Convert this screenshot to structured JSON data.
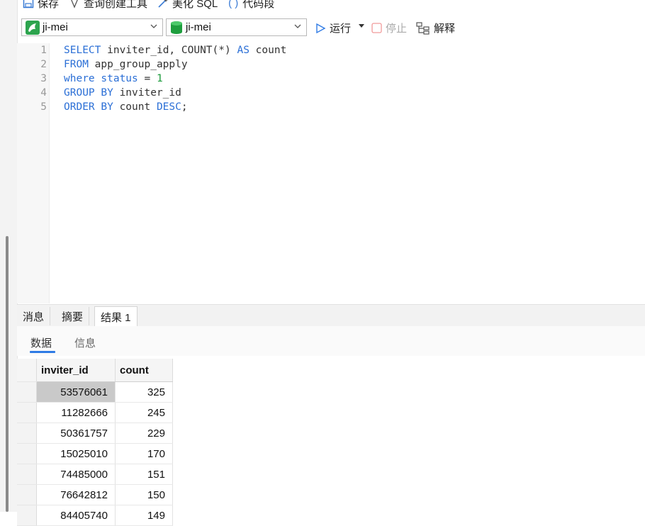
{
  "toolbar_top": {
    "save_label": "保存",
    "query_builder_label": "查询创建工具",
    "beautify_label": "美化 SQL",
    "snippet_label": "代码段"
  },
  "toolbar": {
    "connection_value": "ji-mei",
    "database_value": "ji-mei",
    "run_label": "运行",
    "stop_label": "停止",
    "explain_label": "解释",
    "colors": {
      "connection_icon": "#2da44e",
      "database_icon": "#1e9e3e",
      "run_icon": "#2f7be5"
    }
  },
  "editor": {
    "line_numbers": [
      "1",
      "2",
      "3",
      "4",
      "5"
    ],
    "lines": [
      [
        {
          "t": "SELECT",
          "k": "kw"
        },
        {
          "t": " inviter_id, ",
          "k": "id"
        },
        {
          "t": "COUNT(*)",
          "k": "id"
        },
        {
          "t": " ",
          "k": "id"
        },
        {
          "t": "AS",
          "k": "kw"
        },
        {
          "t": " count",
          "k": "id"
        }
      ],
      [
        {
          "t": "FROM",
          "k": "kw"
        },
        {
          "t": " app_group_apply",
          "k": "id"
        }
      ],
      [
        {
          "t": "where",
          "k": "kw"
        },
        {
          "t": " ",
          "k": "id"
        },
        {
          "t": "status",
          "k": "kw"
        },
        {
          "t": " = ",
          "k": "id"
        },
        {
          "t": "1",
          "k": "num"
        }
      ],
      [
        {
          "t": "GROUP BY",
          "k": "kw"
        },
        {
          "t": " inviter_id",
          "k": "id"
        }
      ],
      [
        {
          "t": "ORDER BY",
          "k": "kw"
        },
        {
          "t": " count ",
          "k": "id"
        },
        {
          "t": "DESC",
          "k": "kw"
        },
        {
          "t": ";",
          "k": "id"
        }
      ]
    ]
  },
  "result_tabs": [
    "消息",
    "摘要",
    "结果 1"
  ],
  "sub_tabs": [
    "数据",
    "信息"
  ],
  "grid": {
    "columns": [
      "inviter_id",
      "count"
    ],
    "rows": [
      [
        "53576061",
        "325"
      ],
      [
        "11282666",
        "245"
      ],
      [
        "50361757",
        "229"
      ],
      [
        "15025010",
        "170"
      ],
      [
        "74485000",
        "151"
      ],
      [
        "76642812",
        "150"
      ],
      [
        "84405740",
        "149"
      ]
    ]
  }
}
